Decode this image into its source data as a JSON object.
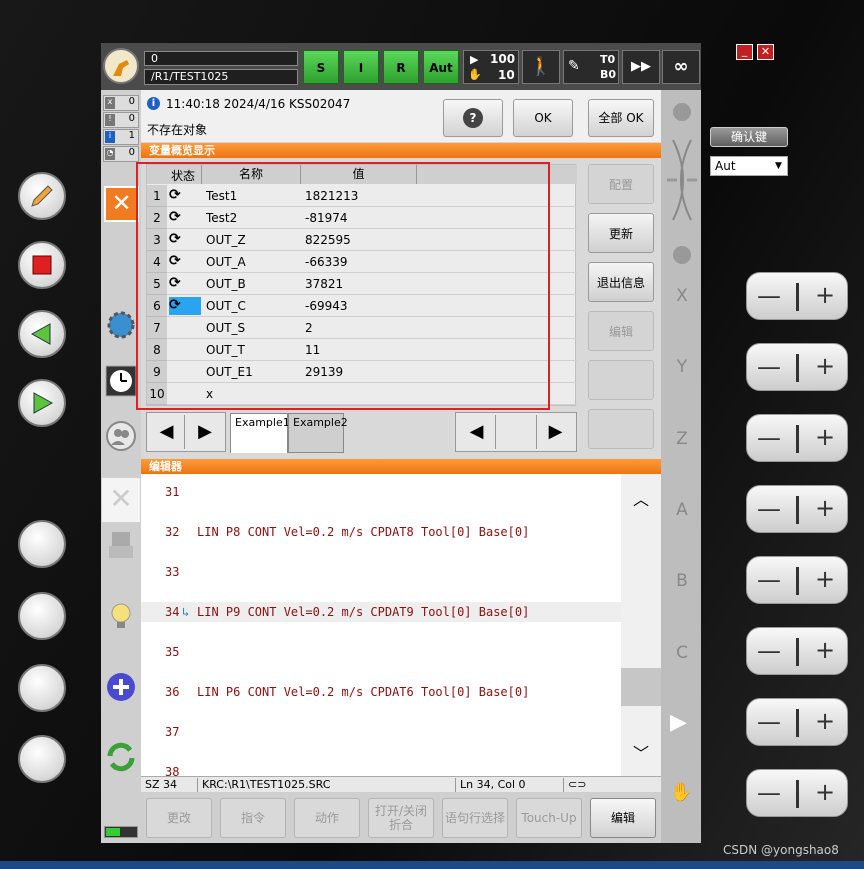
{
  "topbar": {
    "field1": "0",
    "path": "/R1/TEST1025",
    "status_buttons": [
      "S",
      "I",
      "R",
      "Aut"
    ],
    "override_run": "100",
    "override_jog": "10",
    "tool_label": "T0",
    "base_label": "B0",
    "infinity": "∞"
  },
  "left_counts": [
    "0",
    "0",
    "1",
    "0"
  ],
  "message": {
    "time": "11:40:18 2024/4/16 KSS02047",
    "text": "不存在对象",
    "help": "?",
    "ok": "OK",
    "all_ok": "全部 OK"
  },
  "right_outer": {
    "confirm": "确认键",
    "mode": "Aut"
  },
  "var_panel": {
    "title": "变量概览显示",
    "columns": [
      "状态",
      "名称",
      "值"
    ],
    "rows": [
      {
        "n": "1",
        "name": "Test1",
        "value": "1821213",
        "icon": true
      },
      {
        "n": "2",
        "name": "Test2",
        "value": "-81974",
        "icon": true
      },
      {
        "n": "3",
        "name": "OUT_Z",
        "value": "822595",
        "icon": true
      },
      {
        "n": "4",
        "name": "OUT_A",
        "value": "-66339",
        "icon": true
      },
      {
        "n": "5",
        "name": "OUT_B",
        "value": "37821",
        "icon": true
      },
      {
        "n": "6",
        "name": "OUT_C",
        "value": "-69943",
        "icon": true
      },
      {
        "n": "7",
        "name": "OUT_S",
        "value": "2",
        "icon": false
      },
      {
        "n": "8",
        "name": "OUT_T",
        "value": "11",
        "icon": false
      },
      {
        "n": "9",
        "name": "OUT_E1",
        "value": "29139",
        "icon": false
      },
      {
        "n": "10",
        "name": "x",
        "value": "",
        "icon": false
      }
    ],
    "tabs": [
      "Example1",
      "Example2"
    ],
    "buttons": [
      "配置",
      "更新",
      "退出信息",
      "编辑",
      "",
      ""
    ]
  },
  "editor": {
    "title": "编辑器",
    "lines": [
      {
        "n": "31",
        "t": ""
      },
      {
        "n": "32",
        "t": "LIN P8 CONT Vel=0.2 m/s CPDAT8 Tool[0] Base[0]"
      },
      {
        "n": "33",
        "t": ""
      },
      {
        "n": "34",
        "t": "LIN P9 CONT Vel=0.2 m/s CPDAT9 Tool[0] Base[0]"
      },
      {
        "n": "35",
        "t": ""
      },
      {
        "n": "36",
        "t": "LIN P6 CONT Vel=0.2 m/s CPDAT6 Tool[0] Base[0]"
      },
      {
        "n": "37",
        "t": ""
      },
      {
        "n": "38",
        "t": ""
      }
    ]
  },
  "status": {
    "sz": "SZ 34",
    "file": "KRC:\\R1\\TEST1025.SRC",
    "pos": "Ln 34, Col 0"
  },
  "bottom_buttons": [
    "更改",
    "指令",
    "动作",
    "打开/关闭\n折合",
    "语句行选择",
    "Touch-Up",
    "编辑"
  ],
  "axes": [
    "X",
    "Y",
    "Z",
    "A",
    "B",
    "C"
  ],
  "watermark": "CSDN @yongshao8"
}
